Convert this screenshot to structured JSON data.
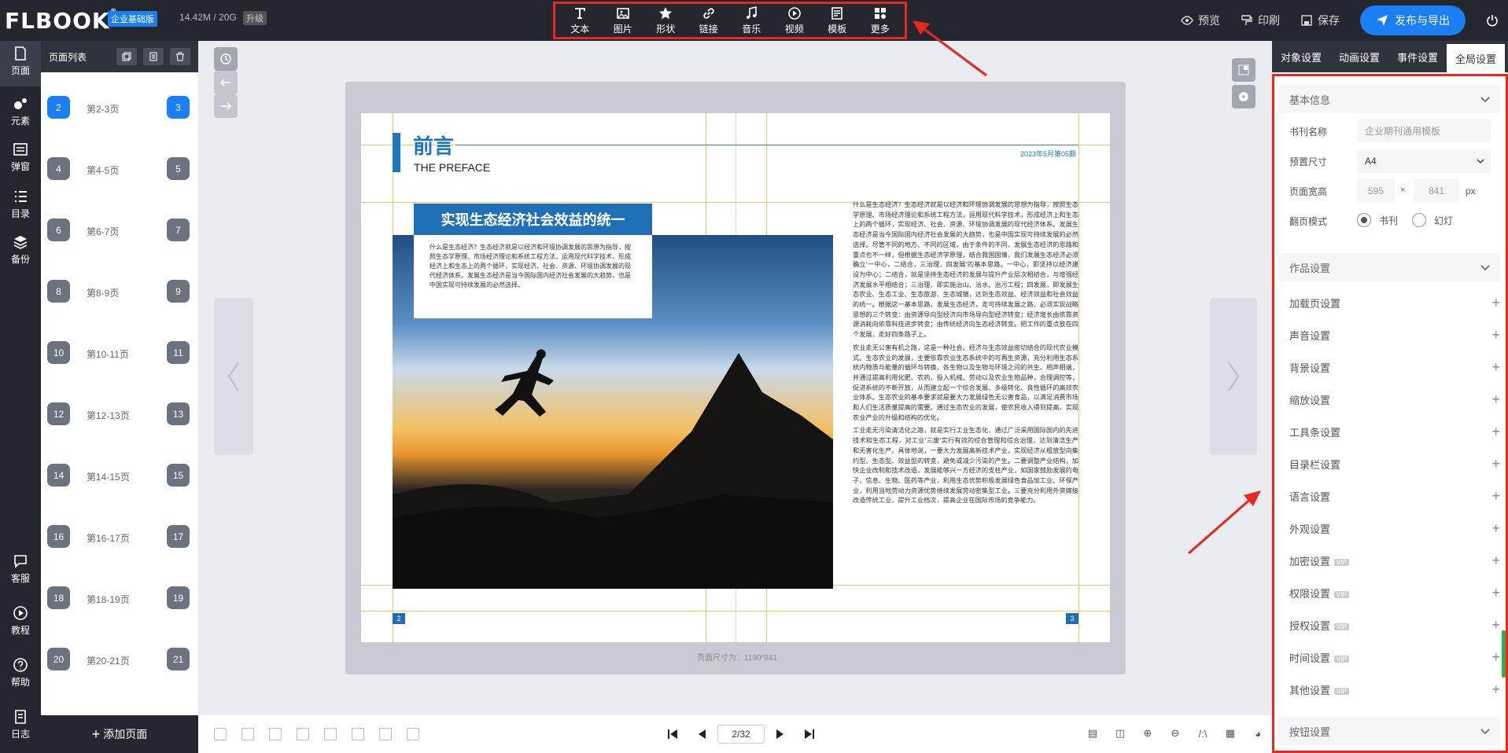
{
  "app": {
    "logo": "FLBOOK",
    "edition": "企业基础版",
    "storage": "14.42M / 20G",
    "upgrade": "升级"
  },
  "toolbar": {
    "items": [
      "文本",
      "图片",
      "形状",
      "链接",
      "音乐",
      "视频",
      "模板",
      "更多"
    ]
  },
  "topright": {
    "preview": "预览",
    "print": "印刷",
    "save": "保存",
    "publish": "发布与导出"
  },
  "leftnav": {
    "items": [
      "页面",
      "元素",
      "弹窗",
      "目录",
      "备份"
    ],
    "bottom": [
      "客服",
      "教程",
      "帮助",
      "日志"
    ]
  },
  "pagelist": {
    "title": "页面列表",
    "rows": [
      {
        "l": "2",
        "label": "第2-3页",
        "r": "3"
      },
      {
        "l": "4",
        "label": "第4-5页",
        "r": "5"
      },
      {
        "l": "6",
        "label": "第6-7页",
        "r": "7"
      },
      {
        "l": "8",
        "label": "第8-9页",
        "r": "9"
      },
      {
        "l": "10",
        "label": "第10-11页",
        "r": "11"
      },
      {
        "l": "12",
        "label": "第12-13页",
        "r": "13"
      },
      {
        "l": "14",
        "label": "第14-15页",
        "r": "15"
      },
      {
        "l": "16",
        "label": "第16-17页",
        "r": "17"
      },
      {
        "l": "18",
        "label": "第18-19页",
        "r": "19"
      },
      {
        "l": "20",
        "label": "第20-21页",
        "r": "21"
      }
    ],
    "add": "添加页面"
  },
  "book": {
    "heading": "前言",
    "subheading": "THE PREFACE",
    "date": "2023年5月第05期",
    "banner": "实现生态经济社会效益的统一",
    "intro": "什么是生态经济？生态经济就是以经济和环境协调发展的思想为指导，按照生态学原理、市场经济理论和系统工程方法，运用现代科学技术，形成经济上和生态上的两个循环，实现经济、社会、资源、环境协调发展的现代经济体系。发展生态经济是当今国际国内经济社会发展的大趋势，也是中国实现可持续发展的必然选择。",
    "col_p1": "什么是生态经济？生态经济就是以经济和环境协调发展的思想为指导，按照生态学原理、市场经济理论和系统工程方法，运用现代科学技术，形成经济上和生态上的两个循环，实现经济、社会、资源、环境协调发展的现代经济体系。发展生态经济是当今国际国内经济社会发展的大趋势，也是中国实现可持续发展的必然选择。尽管不同的地方、不同的区域，由于条件的不同，发展生态经济的思路和重点也不一样，但根据生态经济学原理，结合我国国情，我们发展生态经济必须确立'一中心，二结合，三治理，四发展'的基本思路。一中心，即坚持以经济建设为中心；二结合，就是坚持生态经济的发展与提升产业层次相结合，与增强经济发展水平相结合；三治理，即实施治山、治水、治污工程；四发展，即发展生态农业、生态工业、生态旅游、生态城镇，达到生态效益、经济效益和社会效益的统一。根据这一基本思路，发展生态经济，走可持续发展之路，必须实现战略思想的三个转变：由资源导向型经济向市场导向型经济转变；经济增长由依靠资源消耗向依靠科技进步转变；由传统经济向生态经济转变。把工作的重点放在四个发展，走好四条路子上。",
    "col_p2": "农业走无公害有机之路，这是一种社会、经济与生态效益密切结合的现代农业模式。生态农业的发展，主要依靠农业生态系统中的可再生资源，充分利用生态系统内物质与能量的循环与转换，各生物以及生物与环境之间的共生、相声相谐，并通过提高利用化肥、农药，投入机械、劳动以及农业生物品种，合理调控等，促进系统的不断开放，从而建立起一个综合发展、多级转化、良性循环的高效农业体系。生态农业的基本要求就是要大力发展绿色无公害食品，以满足消费市场和人们生活质量提高的需要。通过生态农业的发展，使农民收入得到提高，实现农业产业的升级和结构的优化。",
    "col_p3": "工业走无污染清洁化之路，就是实行工业生态化，通过广泛采用国际国内的先进技术和生态工程，对工业'三废'实行有效的综合管理和综合治理，达到清洁生产和无害化生产。具体地说，一要大力发展高新技术产业，实现经济从粗放型向集约型、生态型、效益型的转变，避免或减少污染的产生。二要调整产业结构，加快企业改制和技术改造，发展能够兴一方经济的支柱产业，如国家鼓励发展的电子、信息、生物、医药等产业，利用生态优势积极发展绿色食品加工业、环保产业，利用当地劳动力资源优势继续发展劳动密集型工业。三要充分利用外资嫁接改造传统工业，提升工业档次，提高企业在国际市场的竞争能力。",
    "page_left": "2",
    "page_right": "3"
  },
  "canvas": {
    "size_label": "页面尺寸为：1190*841"
  },
  "bottombar": {
    "page_indicator": "2/32"
  },
  "right": {
    "tabs": [
      "对象设置",
      "动画设置",
      "事件设置",
      "全局设置"
    ],
    "basic": {
      "title": "基本信息",
      "name_label": "书刊名称",
      "name_placeholder": "企业期刊通用模板",
      "size_label": "预置尺寸",
      "size_value": "A4",
      "wh_label": "页面宽高",
      "width": "595",
      "times": "×",
      "height": "841",
      "unit": "px",
      "mode_label": "翻页模式",
      "mode_book": "书刊",
      "mode_slide": "幻灯"
    },
    "work": {
      "title": "作品设置"
    },
    "settings": [
      {
        "label": "加载页设置",
        "vip": false
      },
      {
        "label": "声音设置",
        "vip": false
      },
      {
        "label": "背景设置",
        "vip": false
      },
      {
        "label": "缩放设置",
        "vip": false
      },
      {
        "label": "工具条设置",
        "vip": false
      },
      {
        "label": "目录栏设置",
        "vip": false
      },
      {
        "label": "语言设置",
        "vip": false
      },
      {
        "label": "外观设置",
        "vip": false
      },
      {
        "label": "加密设置",
        "vip": true
      },
      {
        "label": "权限设置",
        "vip": true
      },
      {
        "label": "授权设置",
        "vip": true
      },
      {
        "label": "时间设置",
        "vip": true
      },
      {
        "label": "其他设置",
        "vip": true
      }
    ],
    "vip_tag": "VIP",
    "button_section": "按钮设置"
  },
  "colors": {
    "accent": "#1a7ef5",
    "dark": "#24272e",
    "annotation": "#e8271e",
    "guide": "#f0c75a"
  }
}
